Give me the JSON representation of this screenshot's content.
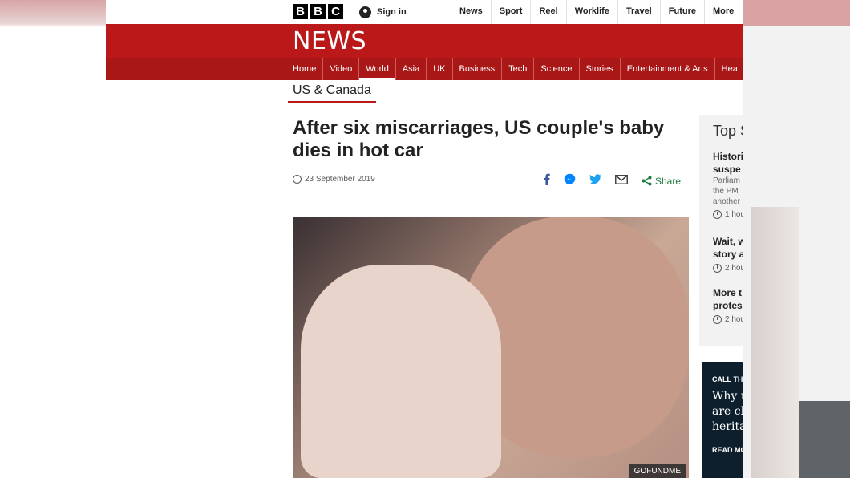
{
  "masthead": {
    "logo_letters": [
      "B",
      "B",
      "C"
    ],
    "sign_in": "Sign in",
    "nav": [
      "News",
      "Sport",
      "Reel",
      "Worklife",
      "Travel",
      "Future",
      "More"
    ]
  },
  "news_bar": {
    "title": "NEWS"
  },
  "section_nav": {
    "items": [
      "Home",
      "Video",
      "World",
      "Asia",
      "UK",
      "Business",
      "Tech",
      "Science",
      "Stories",
      "Entertainment & Arts",
      "Hea"
    ],
    "active": "World"
  },
  "subsection": "US & Canada",
  "article": {
    "headline": "After six miscarriages, US couple's baby dies in hot car",
    "date": "23 September 2019",
    "share_label": "Share",
    "photo_caption": "GOFUNDME"
  },
  "sidebar": {
    "title": "Top S",
    "stories": [
      {
        "title": "Histori\nsuspe",
        "summary": "Parliam\nthe PM\nanother",
        "time": "1 hou"
      },
      {
        "title": "Wait, w\nstory a",
        "summary": "",
        "time": "2 hou"
      },
      {
        "title": "More t\nprotes",
        "summary": "",
        "time": "2 hou"
      }
    ]
  },
  "promo": {
    "kicker": "CALL TH",
    "text": "Why m\nare ch\nherita",
    "cta": "READ MO"
  },
  "colors": {
    "brand_red": "#bb1919",
    "share_green": "#1a7a3a",
    "facebook": "#3b5998",
    "messenger": "#0084ff",
    "twitter": "#1da1f2"
  }
}
